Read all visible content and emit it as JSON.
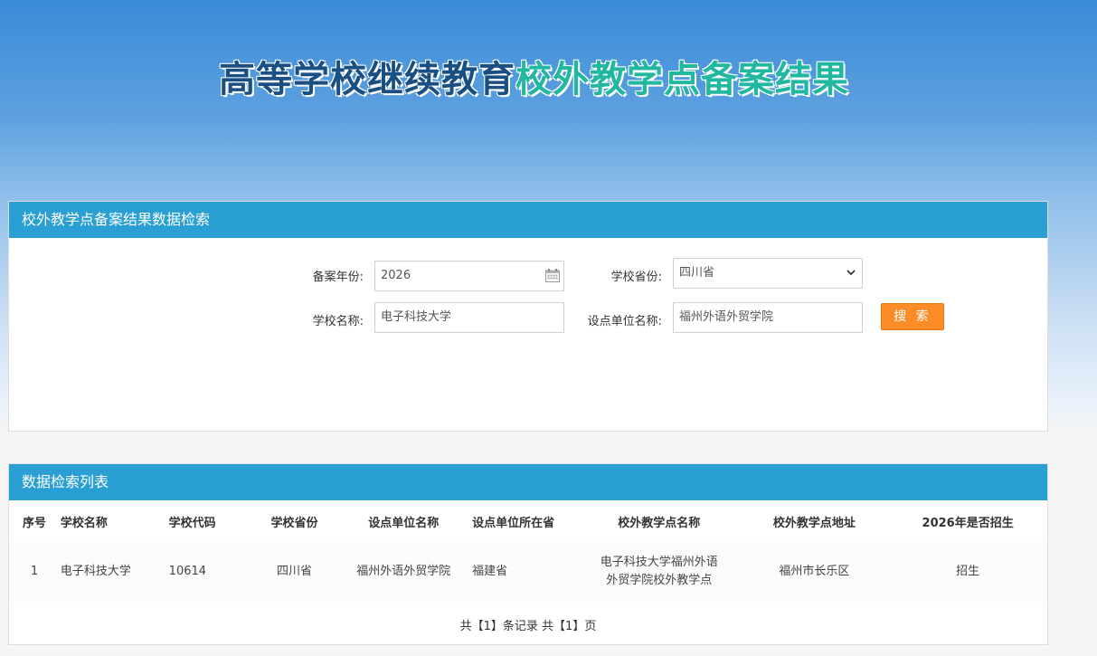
{
  "hero": {
    "title_part1": "高等学校继续教育",
    "title_part2": "校外教学点备案结果"
  },
  "search": {
    "header": "校外教学点备案结果数据检索",
    "year_label": "备案年份:",
    "year_value": "2026",
    "province_label": "学校省份:",
    "province_value": "四川省",
    "school_label": "学校名称:",
    "school_value": "电子科技大学",
    "unit_label": "设点单位名称:",
    "unit_value": "福州外语外贸学院",
    "button": "搜 索"
  },
  "list": {
    "header": "数据检索列表",
    "columns": [
      "序号",
      "学校名称",
      "学校代码",
      "学校省份",
      "设点单位名称",
      "设点单位所在省",
      "校外教学点名称",
      "校外教学点地址",
      "2026年是否招生"
    ],
    "rows": [
      [
        "1",
        "电子科技大学",
        "10614",
        "四川省",
        "福州外语外贸学院",
        "福建省",
        "电子科技大学福州外语外贸学院校外教学点",
        "福州市长乐区",
        "招生"
      ]
    ],
    "pager": "共【1】条记录 共【1】页"
  }
}
